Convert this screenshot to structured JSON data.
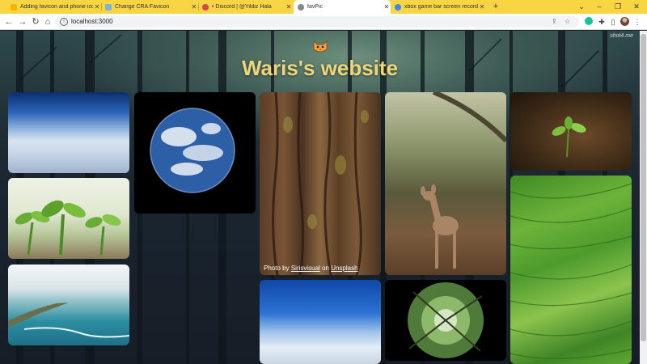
{
  "tabs": [
    {
      "title": "Adding favicon and phone icons",
      "favicon_color": "#f4b400",
      "active": false
    },
    {
      "title": "Change CRA Favicon",
      "favicon_color": "#7fb3d5",
      "active": false
    },
    {
      "title": "• Discord | @Yildiz Hala",
      "favicon_color": "#d64550",
      "active": false
    },
    {
      "title": "favPic",
      "favicon_color": "#888888",
      "active": true
    },
    {
      "title": "xbox game bar screen recording",
      "favicon_color": "#4285f4",
      "active": false
    }
  ],
  "toolbar": {
    "url": "localhost:3000"
  },
  "page": {
    "title": "Waris's website",
    "watermark": "shot4.me",
    "caption": {
      "prefix": "Photo by",
      "author": "Sirisvisual",
      "middle": "on",
      "site": "Unsplash"
    }
  },
  "colors": {
    "tab_strip": "#f9d443",
    "title_text": "#efd67a",
    "page_background": "#1b2630"
  },
  "gallery": [
    "earth-horizon-clouds-photo",
    "earth-globe-photo",
    "tree-bark-photo",
    "deer-in-forest-photo",
    "sapling-close-up-photo",
    "seedlings-photo",
    "beach-coastline-photo",
    "sky-above-clouds-photo",
    "looking-up-at-trees-fisheye-photo",
    "terraced-green-fields-aerial-photo"
  ]
}
